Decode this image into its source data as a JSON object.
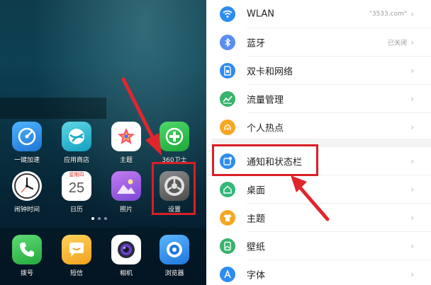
{
  "home": {
    "apps_row1": [
      {
        "label": "一键加速",
        "icon": "speedometer-icon",
        "color": "#2a8fe0"
      },
      {
        "label": "应用商店",
        "icon": "app-store-icon",
        "color": "#1db6c9"
      },
      {
        "label": "主题",
        "icon": "theme-star-icon",
        "color": "#ffffff"
      },
      {
        "label": "360卫士",
        "icon": "360-security-icon",
        "color": "#2fbf4d"
      }
    ],
    "apps_row2": [
      {
        "label": "闹钟时间",
        "icon": "clock-icon",
        "color": "#ffffff"
      },
      {
        "label": "日历",
        "icon": "calendar-icon",
        "color": "#ffffff"
      },
      {
        "label": "照片",
        "icon": "photos-icon",
        "color": "#8a5ad8"
      },
      {
        "label": "设置",
        "icon": "gear-icon",
        "color": "#6d6d6d"
      }
    ],
    "calendar": {
      "weekday": "星期四",
      "day": "25"
    },
    "dock": [
      {
        "label": "拨号",
        "icon": "phone-icon",
        "color": "#33c24d"
      },
      {
        "label": "短信",
        "icon": "message-icon",
        "color": "#f5b63a"
      },
      {
        "label": "相机",
        "icon": "camera-icon",
        "color": "#ffffff"
      },
      {
        "label": "浏览器",
        "icon": "browser-icon",
        "color": "#2b8fe8"
      }
    ]
  },
  "settings": {
    "items": [
      {
        "label": "WLAN",
        "value": "\"3533.com\"",
        "icon": "wifi-icon",
        "color": "#2d8cf0"
      },
      {
        "label": "蓝牙",
        "value": "已关闭",
        "icon": "bluetooth-icon",
        "color": "#5b8def"
      },
      {
        "label": "双卡和网络",
        "value": "",
        "icon": "sim-card-icon",
        "color": "#2d8cf0"
      },
      {
        "label": "流量管理",
        "value": "",
        "icon": "data-usage-icon",
        "color": "#37b36b"
      },
      {
        "label": "个人热点",
        "value": "",
        "icon": "hotspot-icon",
        "color": "#f5a623"
      },
      {
        "label": "通知和状态栏",
        "value": "",
        "icon": "notification-icon",
        "color": "#2d8cf0"
      },
      {
        "label": "桌面",
        "value": "",
        "icon": "home-icon",
        "color": "#33b77a"
      },
      {
        "label": "主题",
        "value": "",
        "icon": "theme-shirt-icon",
        "color": "#f5a623"
      },
      {
        "label": "壁纸",
        "value": "",
        "icon": "wallpaper-icon",
        "color": "#37b36b"
      },
      {
        "label": "字体",
        "value": "",
        "icon": "font-icon",
        "color": "#2d8cf0"
      }
    ]
  },
  "colors": {
    "highlight": "#d91f26",
    "arrow": "#e0262c"
  }
}
